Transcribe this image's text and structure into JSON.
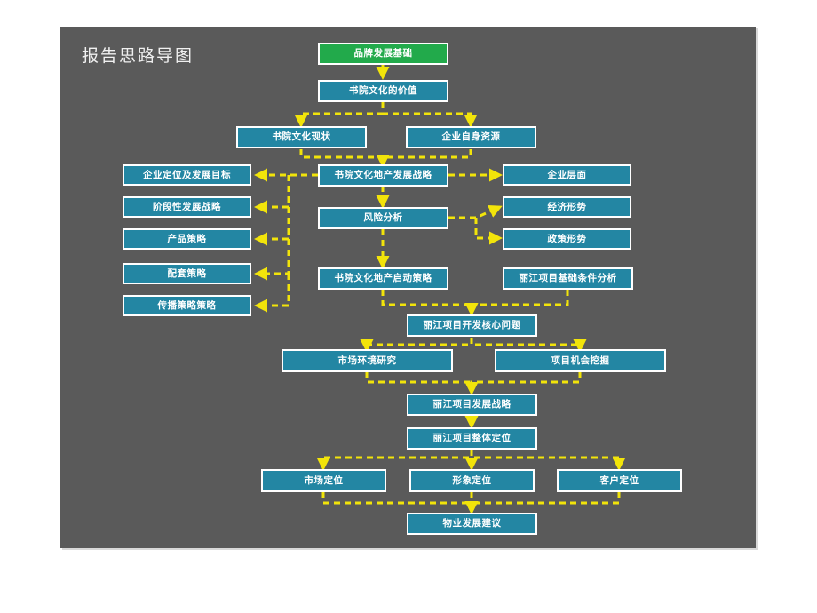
{
  "slide": {
    "title": "报告思路导图",
    "panel_color": "#5a5a5a",
    "node_color": "#2386a3",
    "root_color": "#22aa4b",
    "connector_color": "#f2e40a",
    "border_color": "#ffffff"
  },
  "nodes": {
    "brand_base": "品牌发展基础",
    "academy_value": "书院文化的价值",
    "academy_status": "书院文化现状",
    "enterprise_resource": "企业自身资源",
    "dev_strategy": "书院文化地产发展战略",
    "risk_analysis": "风险分析",
    "startup_strategy": "书院文化地产启动策略",
    "lijiang_basis": "丽江项目基础条件分析",
    "left_1": "企业定位及发展目标",
    "left_2": "阶段性发展战略",
    "left_3": "产品策略",
    "left_4": "配套策略",
    "left_5": "传播策略策略",
    "right_1": "企业层面",
    "right_2": "经济形势",
    "right_3": "政策形势",
    "core_problem": "丽江项目开发核心问题",
    "market_research": "市场环境研究",
    "opportunity": "项目机会挖掘",
    "lijiang_strategy": "丽江项目发展战略",
    "overall_position": "丽江项目整体定位",
    "market_position": "市场定位",
    "image_position": "形象定位",
    "customer_position": "客户定位",
    "property_advice": "物业发展建议"
  }
}
